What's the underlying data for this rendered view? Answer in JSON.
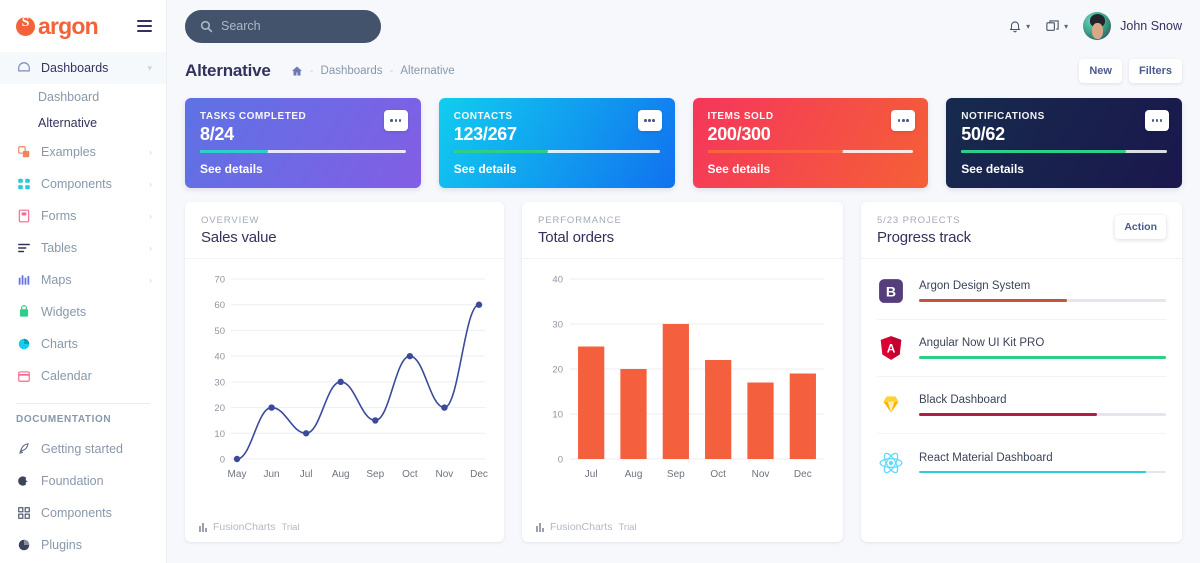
{
  "brand": {
    "name": "argon"
  },
  "search": {
    "placeholder": "Search",
    "icon": "search-icon"
  },
  "topbar": {
    "bell_icon": "bell-icon",
    "apps_icon": "windows-icon",
    "user_name": "John Snow"
  },
  "sidebar": {
    "items": [
      {
        "label": "Dashboards",
        "icon": "dashboard-icon",
        "active": true,
        "caret": "⌄"
      },
      {
        "label": "Examples",
        "icon": "examples-icon",
        "caret": "›"
      },
      {
        "label": "Components",
        "icon": "components-icon",
        "caret": "›"
      },
      {
        "label": "Forms",
        "icon": "forms-icon",
        "caret": "›"
      },
      {
        "label": "Tables",
        "icon": "tables-icon",
        "caret": "›"
      },
      {
        "label": "Maps",
        "icon": "maps-icon",
        "caret": "›"
      },
      {
        "label": "Widgets",
        "icon": "widgets-icon",
        "caret": ""
      },
      {
        "label": "Charts",
        "icon": "charts-icon",
        "caret": ""
      },
      {
        "label": "Calendar",
        "icon": "calendar-icon",
        "caret": ""
      }
    ],
    "sub_items": [
      {
        "label": "Dashboard",
        "current": false
      },
      {
        "label": "Alternative",
        "current": true
      }
    ],
    "doc_heading": "DOCUMENTATION",
    "doc_items": [
      {
        "label": "Getting started",
        "icon": "rocket-icon"
      },
      {
        "label": "Foundation",
        "icon": "palette-icon"
      },
      {
        "label": "Components",
        "icon": "grid-icon"
      },
      {
        "label": "Plugins",
        "icon": "pie-icon"
      }
    ]
  },
  "page": {
    "title": "Alternative",
    "breadcrumb": {
      "home_icon": "home-icon",
      "items": [
        "Dashboards",
        "Alternative"
      ]
    },
    "actions": [
      {
        "label": "New"
      },
      {
        "label": "Filters"
      }
    ]
  },
  "stat_cards": [
    {
      "label": "TASKS COMPLETED",
      "value": "8/24",
      "details": "See details",
      "progress": 33,
      "bg_from": "#5e72e4",
      "bg_to": "#825ee4",
      "fill_color": "#2dcecc"
    },
    {
      "label": "CONTACTS",
      "value": "123/267",
      "details": "See details",
      "progress": 46,
      "bg_from": "#11cdef",
      "bg_to": "#1171ef",
      "fill_color": "#2dce89"
    },
    {
      "label": "ITEMS SOLD",
      "value": "200/300",
      "details": "See details",
      "progress": 66,
      "bg_from": "#f5365c",
      "bg_to": "#f56036",
      "fill_color": "#fb6340"
    },
    {
      "label": "NOTIFICATIONS",
      "value": "50/62",
      "details": "See details",
      "progress": 80,
      "bg_from": "#172b4d",
      "bg_to": "#1a174d",
      "fill_color": "#2dce89"
    }
  ],
  "sales_card": {
    "eyebrow": "OVERVIEW",
    "title": "Sales value",
    "watermark": "FusionCharts",
    "watermark_suffix": "Trial"
  },
  "orders_card": {
    "eyebrow": "PERFORMANCE",
    "title": "Total orders",
    "watermark": "FusionCharts",
    "watermark_suffix": "Trial"
  },
  "progress_card": {
    "eyebrow": "5/23 PROJECTS",
    "title": "Progress track",
    "action_label": "Action",
    "rows": [
      {
        "name": "Argon Design System",
        "icon": "bootstrap-icon",
        "progress": 60,
        "color": "#c0563a"
      },
      {
        "name": "Angular Now UI Kit PRO",
        "icon": "angular-icon",
        "progress": 100,
        "color": "#2dce89"
      },
      {
        "name": "Black Dashboard",
        "icon": "sketch-icon",
        "progress": 72,
        "color": "#b01e46"
      },
      {
        "name": "React Material Dashboard",
        "icon": "react-icon",
        "progress": 92,
        "color": "#2bcbd8"
      }
    ]
  },
  "chart_data": [
    {
      "type": "line",
      "title": "Sales value",
      "categories": [
        "May",
        "Jun",
        "Jul",
        "Aug",
        "Sep",
        "Oct",
        "Nov",
        "Dec"
      ],
      "values": [
        0,
        20,
        10,
        30,
        15,
        40,
        20,
        60
      ],
      "yticks": [
        0,
        10,
        20,
        30,
        40,
        50,
        60,
        70
      ],
      "ylim": [
        0,
        70
      ],
      "xlabel": "",
      "ylabel": "",
      "series_color": "#3b4a9c",
      "grid": true,
      "legend": "none"
    },
    {
      "type": "bar",
      "title": "Total orders",
      "categories": [
        "Jul",
        "Aug",
        "Sep",
        "Oct",
        "Nov",
        "Dec"
      ],
      "values": [
        25,
        20,
        30,
        22,
        17,
        19
      ],
      "yticks": [
        0,
        10,
        20,
        30,
        40
      ],
      "ylim": [
        0,
        40
      ],
      "xlabel": "",
      "ylabel": "",
      "series_color": "#f4603e",
      "grid": true,
      "legend": "none"
    }
  ]
}
